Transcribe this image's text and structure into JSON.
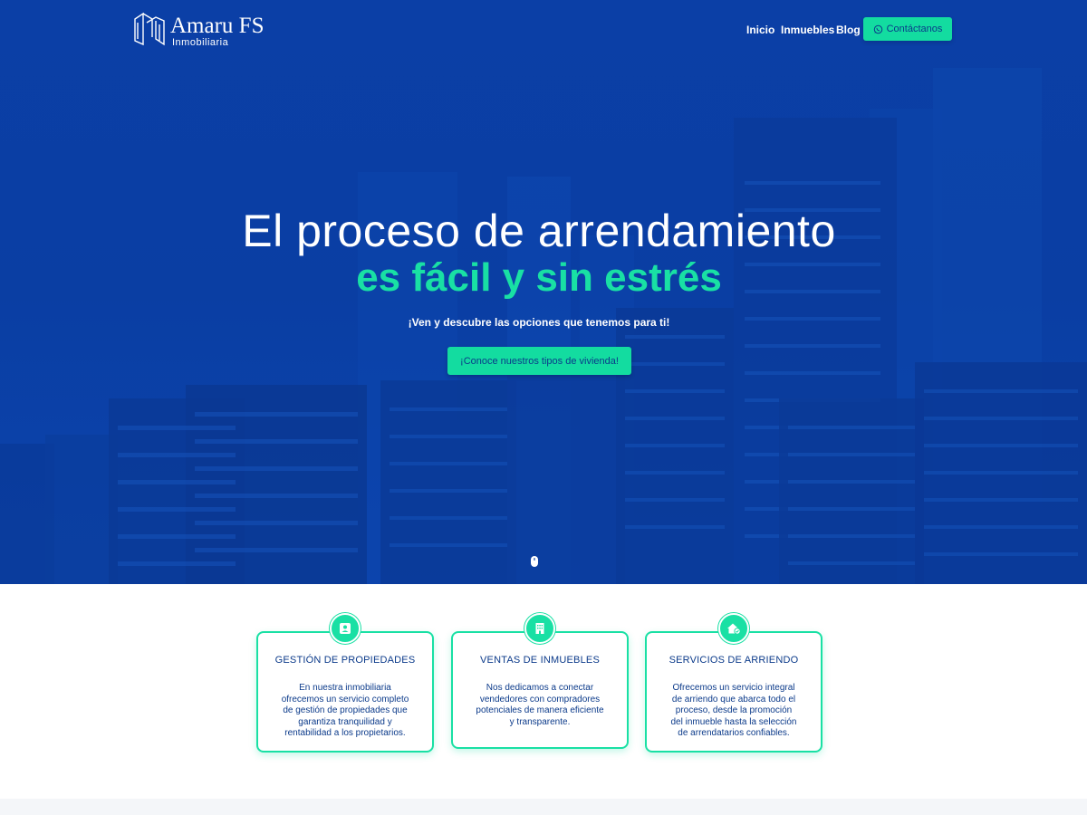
{
  "brand": {
    "name": "Amaru FS",
    "tagline": "Inmobiliaria"
  },
  "nav": {
    "links": [
      "Inicio",
      "Inmuebles",
      "Blog"
    ],
    "cta_label": "Contáctanos",
    "cta_icon": "whatsapp-icon"
  },
  "hero": {
    "title_line1": "El proceso de arrendamiento",
    "title_line2": "es fácil y sin estrés",
    "subtitle": "¡Ven y descubre las opciones que tenemos para ti!",
    "button_label": "¡Conoce nuestros tipos de vivienda!",
    "scroll_icon": "mouse-scroll-icon"
  },
  "services": [
    {
      "icon": "person-badge-icon",
      "title": "GESTIÓN DE PROPIEDADES",
      "text": "En nuestra inmobiliaria ofrecemos un servicio completo de gestión de propiedades que garantiza tranquilidad y rentabilidad a los propietarios."
    },
    {
      "icon": "building-icon",
      "title": "VENTAS DE INMUEBLES",
      "text": "Nos dedicamos a conectar vendedores con compradores potenciales de manera eficiente y transparente."
    },
    {
      "icon": "house-check-icon",
      "title": "SERVICIOS DE ARRIENDO",
      "text": "Ofrecemos un servicio integral de arriendo que abarca todo el proceso, desde la promoción del inmueble hasta la selección de arrendatarios confiables."
    }
  ],
  "colors": {
    "primary_blue": "#0b3fa6",
    "accent_green": "#19e0a4",
    "text_navy": "#0b3a8a"
  }
}
